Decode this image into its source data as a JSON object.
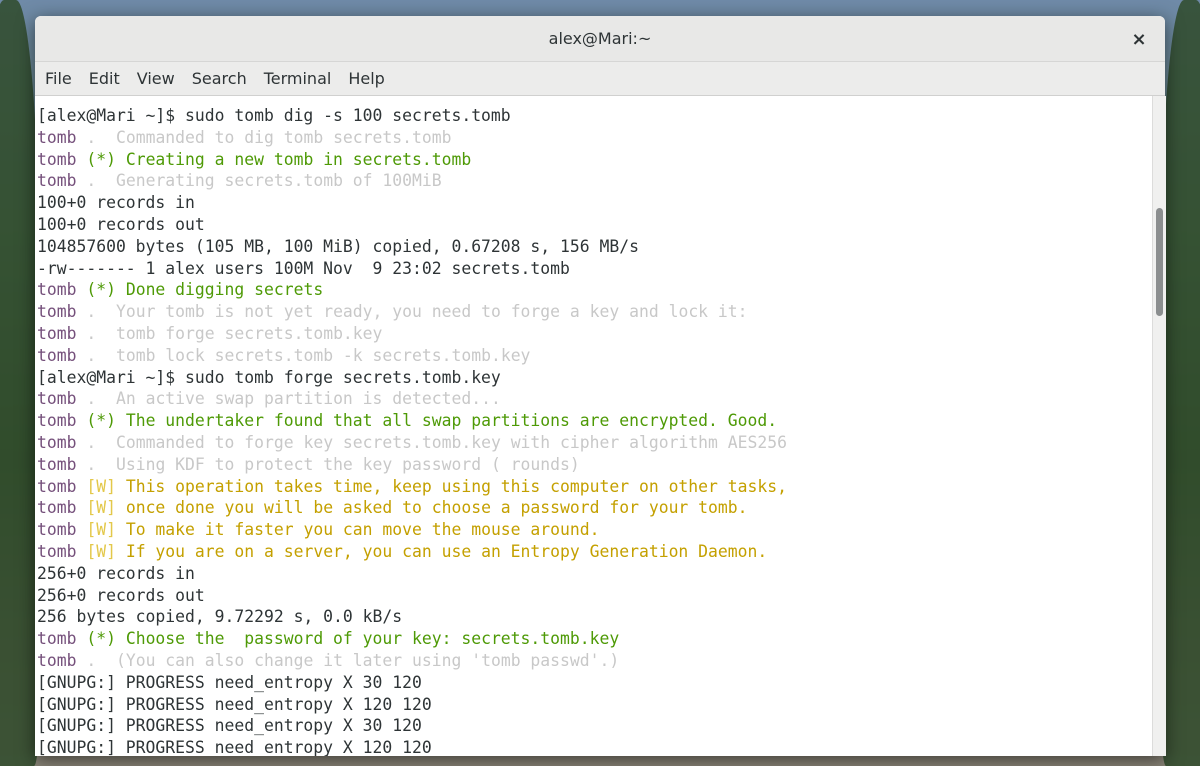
{
  "window": {
    "title": "alex@Mari:~",
    "close_glyph": "×"
  },
  "menu": [
    "File",
    "Edit",
    "View",
    "Search",
    "Terminal",
    "Help"
  ],
  "colors": {
    "tomb": "#75507b",
    "dim": "#c8c8c8",
    "green": "#4e9a06",
    "yellow": "#c4a000",
    "plain": "#2e3436"
  },
  "terminal": {
    "lines": [
      {
        "kind": "plain",
        "text": "[alex@Mari ~]$ sudo tomb dig -s 100 secrets.tomb"
      },
      {
        "kind": "dim",
        "text": "Commanded to dig tomb secrets.tomb"
      },
      {
        "kind": "ok",
        "text": "Creating a new tomb in secrets.tomb"
      },
      {
        "kind": "dim",
        "text": "Generating secrets.tomb of 100MiB"
      },
      {
        "kind": "plain",
        "text": "100+0 records in"
      },
      {
        "kind": "plain",
        "text": "100+0 records out"
      },
      {
        "kind": "plain",
        "text": "104857600 bytes (105 MB, 100 MiB) copied, 0.67208 s, 156 MB/s"
      },
      {
        "kind": "plain",
        "text": "-rw------- 1 alex users 100M Nov  9 23:02 secrets.tomb"
      },
      {
        "kind": "ok",
        "text": "Done digging secrets"
      },
      {
        "kind": "dim",
        "text": "Your tomb is not yet ready, you need to forge a key and lock it:"
      },
      {
        "kind": "dim",
        "text": "tomb forge secrets.tomb.key"
      },
      {
        "kind": "dim",
        "text": "tomb lock secrets.tomb -k secrets.tomb.key"
      },
      {
        "kind": "plain",
        "text": "[alex@Mari ~]$ sudo tomb forge secrets.tomb.key"
      },
      {
        "kind": "dim",
        "text": "An active swap partition is detected..."
      },
      {
        "kind": "ok",
        "text": "The undertaker found that all swap partitions are encrypted. Good."
      },
      {
        "kind": "dim",
        "text": "Commanded to forge key secrets.tomb.key with cipher algorithm AES256"
      },
      {
        "kind": "dim",
        "text": "Using KDF to protect the key password ( rounds)"
      },
      {
        "kind": "warn",
        "text": "This operation takes time, keep using this computer on other tasks,"
      },
      {
        "kind": "warn",
        "text": "once done you will be asked to choose a password for your tomb."
      },
      {
        "kind": "warn",
        "text": "To make it faster you can move the mouse around."
      },
      {
        "kind": "warn",
        "text": "If you are on a server, you can use an Entropy Generation Daemon."
      },
      {
        "kind": "plain",
        "text": "256+0 records in"
      },
      {
        "kind": "plain",
        "text": "256+0 records out"
      },
      {
        "kind": "plain",
        "text": "256 bytes copied, 9.72292 s, 0.0 kB/s"
      },
      {
        "kind": "ok",
        "text": "Choose the  password of your key: secrets.tomb.key"
      },
      {
        "kind": "dim",
        "text": "(You can also change it later using 'tomb passwd'.)"
      },
      {
        "kind": "plain",
        "text": "[GNUPG:] PROGRESS need_entropy X 30 120"
      },
      {
        "kind": "plain",
        "text": "[GNUPG:] PROGRESS need_entropy X 120 120"
      },
      {
        "kind": "plain",
        "text": "[GNUPG:] PROGRESS need_entropy X 30 120"
      },
      {
        "kind": "plain",
        "text": "[GNUPG:] PROGRESS need_entropy X 120 120"
      }
    ],
    "prefix_word": "tomb",
    "marker_dim": " .  ",
    "marker_ok": " (*) ",
    "marker_warn": " [W] "
  }
}
